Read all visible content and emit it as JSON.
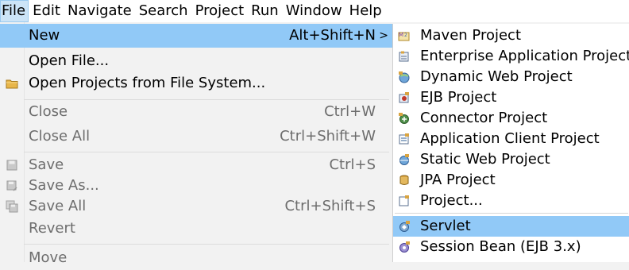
{
  "menubar": {
    "items": [
      {
        "label": "File"
      },
      {
        "label": "Edit"
      },
      {
        "label": "Navigate"
      },
      {
        "label": "Search"
      },
      {
        "label": "Project"
      },
      {
        "label": "Run"
      },
      {
        "label": "Window"
      },
      {
        "label": "Help"
      }
    ]
  },
  "file_menu": {
    "items": [
      {
        "label": "New",
        "accel": "Alt+Shift+N",
        "submenu_arrow": ">"
      },
      {
        "label": "Open File..."
      },
      {
        "label": "Open Projects from File System...",
        "icon": "folder-icon"
      },
      {
        "label": "Close",
        "accel": "Ctrl+W"
      },
      {
        "label": "Close All",
        "accel": "Ctrl+Shift+W"
      },
      {
        "label": "Save",
        "accel": "Ctrl+S",
        "icon": "save-icon"
      },
      {
        "label": "Save As...",
        "icon": "save-as-icon"
      },
      {
        "label": "Save All",
        "accel": "Ctrl+Shift+S",
        "icon": "save-all-icon"
      },
      {
        "label": "Revert"
      },
      {
        "label": "Move"
      }
    ]
  },
  "new_submenu": {
    "items": [
      {
        "label": "Maven Project",
        "icon": "maven-project-icon"
      },
      {
        "label": "Enterprise Application Project",
        "icon": "enterprise-project-icon"
      },
      {
        "label": "Dynamic Web Project",
        "icon": "dynamic-web-project-icon"
      },
      {
        "label": "EJB Project",
        "icon": "ejb-project-icon"
      },
      {
        "label": "Connector Project",
        "icon": "connector-project-icon"
      },
      {
        "label": "Application Client Project",
        "icon": "app-client-project-icon"
      },
      {
        "label": "Static Web Project",
        "icon": "static-web-project-icon"
      },
      {
        "label": "JPA Project",
        "icon": "jpa-project-icon"
      },
      {
        "label": "Project...",
        "icon": "project-icon"
      },
      {
        "label": "Servlet",
        "icon": "servlet-icon"
      },
      {
        "label": "Session Bean (EJB 3.x)",
        "icon": "session-bean-icon"
      }
    ]
  },
  "colors": {
    "selection": "#91c9f7",
    "menubar_active": "#cce4f7",
    "disabled_text": "#6d6d6d",
    "menu_background": "#f2f2f2"
  }
}
